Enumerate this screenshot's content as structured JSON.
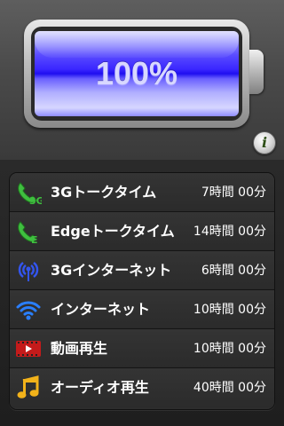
{
  "battery": {
    "percent_label": "100%",
    "level": 1.0,
    "fill_color": "#3a26ff"
  },
  "info_button": {
    "glyph": "i",
    "icon": "info-icon"
  },
  "usage_list": [
    {
      "icon": "phone-3g-icon",
      "icon_text": "3G",
      "label": "3Gトークタイム",
      "value": "7時間 00分"
    },
    {
      "icon": "phone-edge-icon",
      "icon_text": "E",
      "label": "Edgeトークタイム",
      "value": "14時間 00分"
    },
    {
      "icon": "antenna-3g-icon",
      "label": "3Gインターネット",
      "value": "6時間 00分"
    },
    {
      "icon": "wifi-icon",
      "label": "インターネット",
      "value": "10時間 00分"
    },
    {
      "icon": "video-film-icon",
      "label": "動画再生",
      "value": "10時間 00分"
    },
    {
      "icon": "music-note-icon",
      "label": "オーディオ再生",
      "value": "40時間 00分"
    }
  ]
}
